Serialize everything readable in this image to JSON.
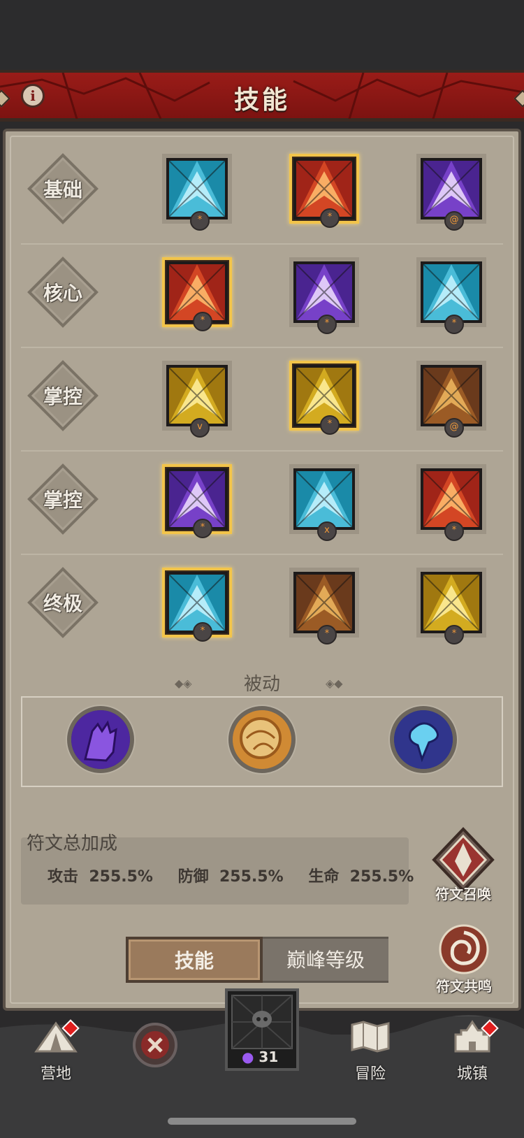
{
  "header": {
    "title": "技能",
    "info_icon": "i"
  },
  "categories": [
    "基础",
    "核心",
    "掌控",
    "掌控",
    "终极"
  ],
  "skills": [
    [
      {
        "icon": "ice-spear-icon",
        "frame": "blue",
        "selected": false,
        "rune": "*"
      },
      {
        "icon": "fire-claw-icon",
        "frame": "red",
        "selected": true,
        "rune": "*"
      },
      {
        "icon": "lightning-icon",
        "frame": "purple",
        "selected": false,
        "rune": "@"
      }
    ],
    [
      {
        "icon": "fireball-icon",
        "frame": "red",
        "selected": true,
        "rune": "*"
      },
      {
        "icon": "shock-fist-icon",
        "frame": "purple",
        "selected": false,
        "rune": "*"
      },
      {
        "icon": "ice-shards-icon",
        "frame": "blue",
        "selected": false,
        "rune": "*"
      }
    ],
    [
      {
        "icon": "crown-spikes-icon",
        "frame": "gold",
        "selected": false,
        "rune": "v"
      },
      {
        "icon": "dash-figure-icon",
        "frame": "gold",
        "selected": true,
        "rune": "*"
      },
      {
        "icon": "fire-vortex-icon",
        "frame": "brown",
        "selected": false,
        "rune": "@"
      }
    ],
    [
      {
        "icon": "lightning-orb-icon",
        "frame": "purple",
        "selected": true,
        "rune": "*"
      },
      {
        "icon": "snowflake-icon",
        "frame": "blue",
        "selected": false,
        "rune": "x"
      },
      {
        "icon": "fire-beast-icon",
        "frame": "red",
        "selected": false,
        "rune": "*"
      }
    ],
    [
      {
        "icon": "ice-tornado-icon",
        "frame": "blue",
        "selected": true,
        "rune": "*"
      },
      {
        "icon": "clone-figures-icon",
        "frame": "brown",
        "selected": false,
        "rune": "*"
      },
      {
        "icon": "golden-figure-icon",
        "frame": "gold",
        "selected": false,
        "rune": "*"
      }
    ]
  ],
  "passive": {
    "title": "被动",
    "orbs": [
      "purple-hand-icon",
      "golden-stone-icon",
      "blue-spirit-icon"
    ]
  },
  "bonus": {
    "title": "符文总加成",
    "stats": [
      {
        "label": "攻击",
        "value": "255.5%"
      },
      {
        "label": "防御",
        "value": "255.5%"
      },
      {
        "label": "生命",
        "value": "255.5%"
      }
    ]
  },
  "side_buttons": {
    "summon": "符文召唤",
    "resonance": "符文共鸣"
  },
  "tabs": {
    "skill": "技能",
    "peak": "巅峰等级"
  },
  "nav": {
    "camp": "营地",
    "adventure": "冒险",
    "town": "城镇",
    "currency": "31"
  },
  "colors": {
    "banner": "#8c1714",
    "parchment": "#aea595",
    "gold_frame": "#f2c44a"
  }
}
